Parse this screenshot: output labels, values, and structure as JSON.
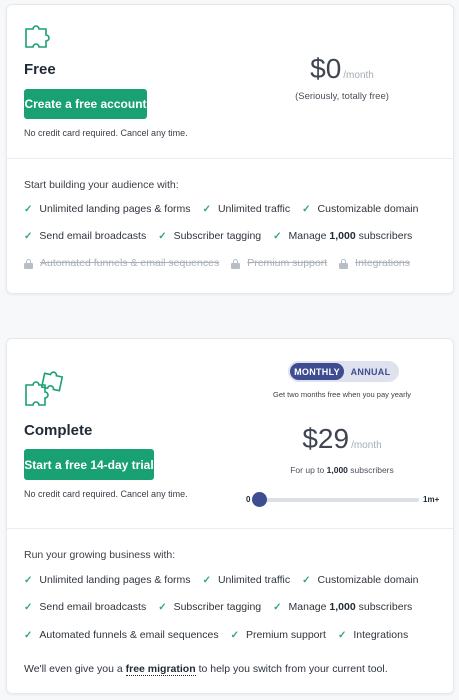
{
  "colors": {
    "accent_green": "#1aa173",
    "toggle_blue": "#3e4c92",
    "check_green": "#32a77c"
  },
  "free_plan": {
    "icon": "puzzle-piece-icon",
    "name": "Free",
    "cta_label": "Create a free account",
    "note": "No credit card required. Cancel any time.",
    "price": "$0",
    "per": "/month",
    "price_note": "(Seriously, totally free)",
    "lead": "Start building your audience with:",
    "feature_rows": [
      [
        {
          "label": "Unlimited landing pages & forms",
          "enabled": true
        },
        {
          "label": "Unlimited traffic",
          "enabled": true
        },
        {
          "label": "Customizable domain",
          "enabled": true
        }
      ],
      [
        {
          "label": "Send email broadcasts",
          "enabled": true
        },
        {
          "label": "Subscriber tagging",
          "enabled": true
        },
        {
          "label_pre": "Manage",
          "label_bold": "1,000",
          "label_post": "subscribers",
          "enabled": true
        }
      ],
      [
        {
          "label": "Automated funnels & email sequences",
          "enabled": false
        },
        {
          "label": "Premium support",
          "enabled": false
        },
        {
          "label": "Integrations",
          "enabled": false
        }
      ]
    ]
  },
  "complete_plan": {
    "icon": "puzzle-pieces-icon",
    "name": "Complete",
    "billing_toggle": {
      "options": [
        "MONTHLY",
        "ANNUAL"
      ],
      "selected": "MONTHLY",
      "note": "Get two months free when you pay yearly"
    },
    "cta_label": "Start a free 14-day trial",
    "note": "No credit card required. Cancel any time.",
    "price": "$29",
    "per": "/month",
    "subscribers_pre": "For up to",
    "subscribers_count": "1,000",
    "subscribers_post": "subscribers",
    "slider": {
      "min_label": "0",
      "max_label": "1m+",
      "value_fraction": 0.0
    },
    "lead": "Run your growing business with:",
    "feature_rows": [
      [
        {
          "label": "Unlimited landing pages & forms"
        },
        {
          "label": "Unlimited traffic"
        },
        {
          "label": "Customizable domain"
        }
      ],
      [
        {
          "label": "Send email broadcasts"
        },
        {
          "label": "Subscriber tagging"
        },
        {
          "label_pre": "Manage",
          "label_bold": "1,000",
          "label_post": "subscribers"
        }
      ],
      [
        {
          "label": "Automated funnels & email sequences"
        },
        {
          "label": "Premium support"
        },
        {
          "label": "Integrations"
        }
      ]
    ],
    "migration_pre": "We'll even give you a",
    "migration_link": "free migration",
    "migration_post": "to help you switch from your current tool."
  }
}
